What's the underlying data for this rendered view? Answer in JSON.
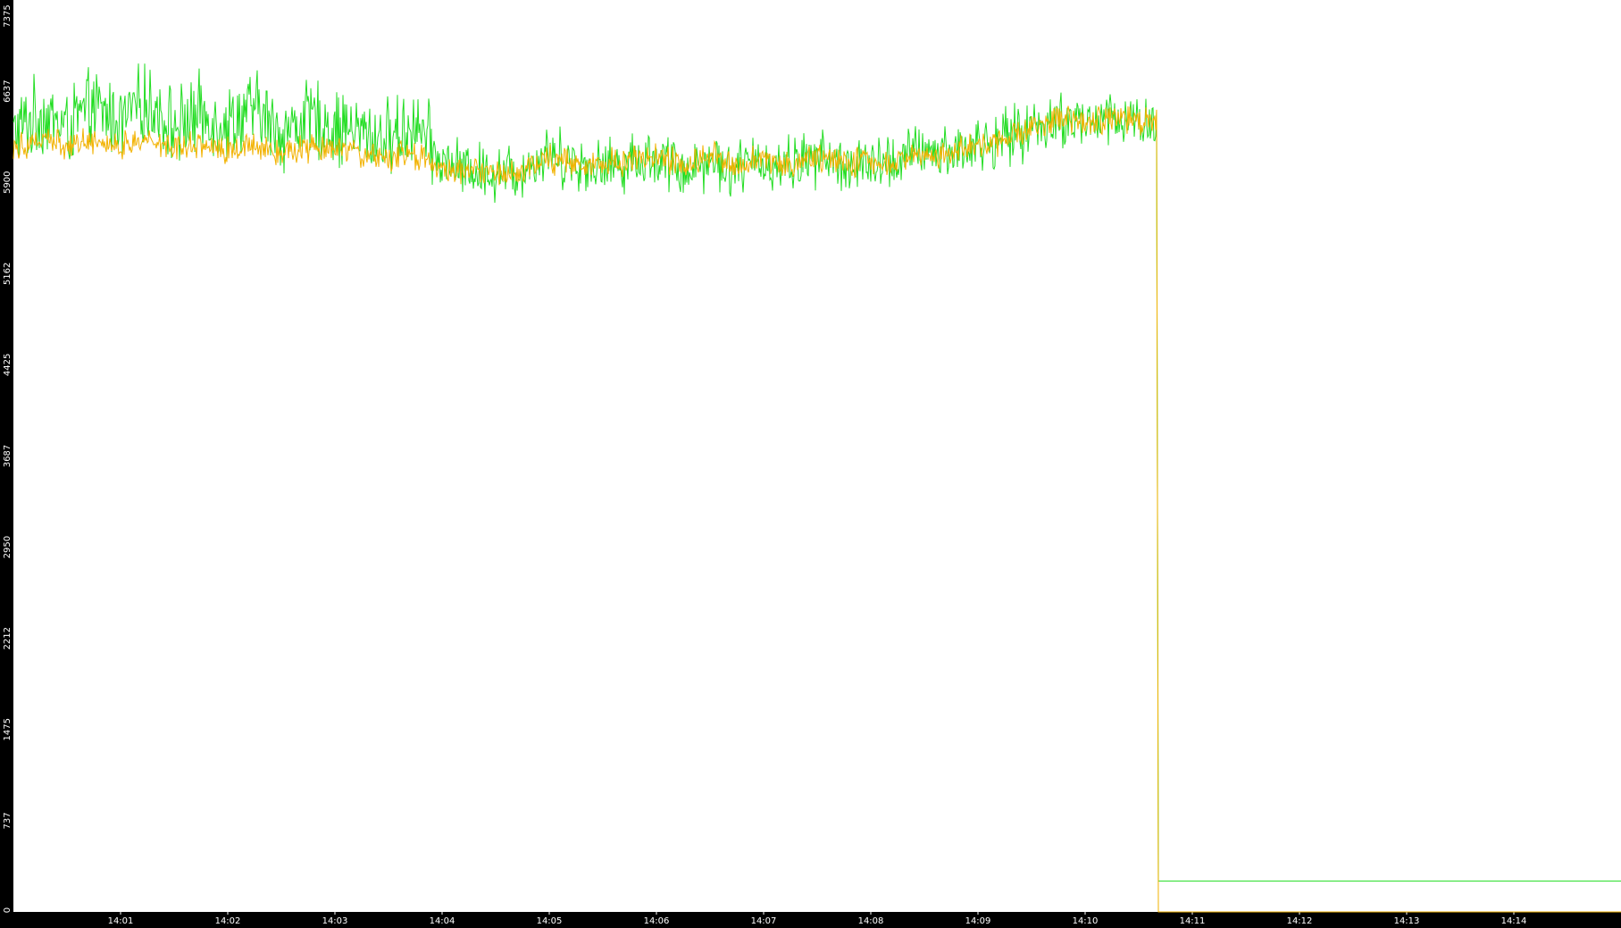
{
  "chart_data": {
    "type": "line",
    "title": "",
    "xlabel": "",
    "ylabel": "",
    "ylim": [
      0,
      7375
    ],
    "xlim": [
      "14:00:00",
      "14:15:00"
    ],
    "grid": false,
    "legend": "none",
    "background": "#ffffff",
    "frame_color": "#000000",
    "y_ticks": [
      "0",
      "737",
      "1475",
      "2212",
      "2950",
      "3687",
      "4425",
      "5162",
      "5900",
      "6637",
      "7375"
    ],
    "x_ticks": [
      "14:01",
      "14:02",
      "14:03",
      "14:04",
      "14:05",
      "14:06",
      "14:07",
      "14:08",
      "14:09",
      "14:10",
      "14:11",
      "14:12",
      "14:13",
      "14:14"
    ],
    "series": [
      {
        "color": "#22dd22",
        "x": [
          "14:00:00",
          "14:00:15",
          "14:00:30",
          "14:00:45",
          "14:01:00",
          "14:01:15",
          "14:01:30",
          "14:01:45",
          "14:02:00",
          "14:02:15",
          "14:02:30",
          "14:02:45",
          "14:03:00",
          "14:03:15",
          "14:03:30",
          "14:03:45",
          "14:04:00",
          "14:04:15",
          "14:04:30",
          "14:04:45",
          "14:05:00",
          "14:05:15",
          "14:05:30",
          "14:05:45",
          "14:06:00",
          "14:06:15",
          "14:06:30",
          "14:06:45",
          "14:07:00",
          "14:07:15",
          "14:07:30",
          "14:07:45",
          "14:08:00",
          "14:08:15",
          "14:08:30",
          "14:08:45",
          "14:09:00",
          "14:09:15",
          "14:09:30",
          "14:09:45",
          "14:10:00",
          "14:10:15",
          "14:10:30",
          "14:10:40",
          "14:10:41",
          "14:15:00"
        ],
        "values": [
          6300,
          6450,
          6350,
          6500,
          6400,
          6550,
          6350,
          6450,
          6380,
          6500,
          6300,
          6420,
          6350,
          6300,
          6250,
          6380,
          6050,
          6000,
          5980,
          6000,
          6150,
          6050,
          6020,
          6080,
          6100,
          6000,
          6080,
          6020,
          6060,
          6050,
          6100,
          6050,
          6020,
          6080,
          6150,
          6150,
          6200,
          6250,
          6350,
          6400,
          6380,
          6420,
          6400,
          6380,
          250,
          250
        ],
        "noise_amplitude": 280,
        "noise_until": "14:10:40"
      },
      {
        "color": "#f2b200",
        "x": [
          "14:00:00",
          "14:00:15",
          "14:00:30",
          "14:00:45",
          "14:01:00",
          "14:01:15",
          "14:01:30",
          "14:01:45",
          "14:02:00",
          "14:02:15",
          "14:02:30",
          "14:02:45",
          "14:03:00",
          "14:03:15",
          "14:03:30",
          "14:03:45",
          "14:04:00",
          "14:04:15",
          "14:04:30",
          "14:04:45",
          "14:05:00",
          "14:05:15",
          "14:05:30",
          "14:05:45",
          "14:06:00",
          "14:06:15",
          "14:06:30",
          "14:06:45",
          "14:07:00",
          "14:07:15",
          "14:07:30",
          "14:07:45",
          "14:08:00",
          "14:08:15",
          "14:08:30",
          "14:08:45",
          "14:09:00",
          "14:09:15",
          "14:09:30",
          "14:09:45",
          "14:10:00",
          "14:10:15",
          "14:10:30",
          "14:10:40",
          "14:10:41",
          "14:15:00"
        ],
        "values": [
          6200,
          6250,
          6200,
          6250,
          6180,
          6250,
          6200,
          6220,
          6150,
          6220,
          6150,
          6180,
          6150,
          6120,
          6100,
          6120,
          6000,
          6000,
          5980,
          6000,
          6100,
          6050,
          6050,
          6080,
          6100,
          6050,
          6120,
          6060,
          6080,
          6050,
          6100,
          6080,
          6050,
          6060,
          6120,
          6150,
          6200,
          6250,
          6350,
          6400,
          6380,
          6420,
          6400,
          6380,
          0,
          0
        ],
        "noise_amplitude": 140,
        "noise_until": "14:10:40"
      }
    ]
  }
}
